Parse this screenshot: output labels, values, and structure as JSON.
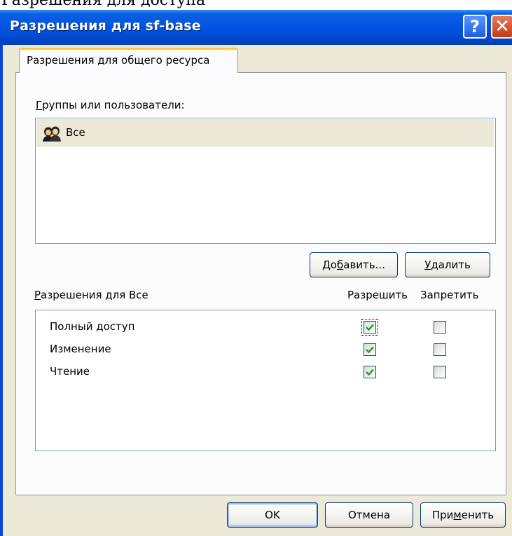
{
  "window": {
    "title": "Разрешения для sf-base",
    "help_glyph": "?",
    "close_glyph": "✕"
  },
  "background_text": "Разрешения для доступа",
  "tab": {
    "label": "Разрешения для общего ресурса"
  },
  "groups": {
    "label_prefix": "",
    "label_accel": "Г",
    "label_rest": "руппы или пользователи:",
    "users": [
      {
        "name": "Все",
        "selected": true
      }
    ]
  },
  "buttons": {
    "add": {
      "pre": "До",
      "accel": "б",
      "post": "авить..."
    },
    "remove": {
      "pre": "",
      "accel": "У",
      "post": "далить"
    },
    "ok": "OK",
    "cancel": "Отмена",
    "apply": {
      "pre": "При",
      "accel": "м",
      "post": "енить"
    }
  },
  "permissions": {
    "label_accel": "Р",
    "label_rest": "азрешения для Все",
    "col_allow": "Разрешить",
    "col_deny": "Запретить",
    "rows": [
      {
        "name": "Полный доступ",
        "allow": true,
        "deny": false
      },
      {
        "name": "Изменение",
        "allow": true,
        "deny": false
      },
      {
        "name": "Чтение",
        "allow": true,
        "deny": false
      }
    ]
  },
  "colors": {
    "titlebar": "#0054e3",
    "window_bg": "#ece9d8",
    "tab_highlight": "#ffc83c",
    "check": "#21a121"
  }
}
